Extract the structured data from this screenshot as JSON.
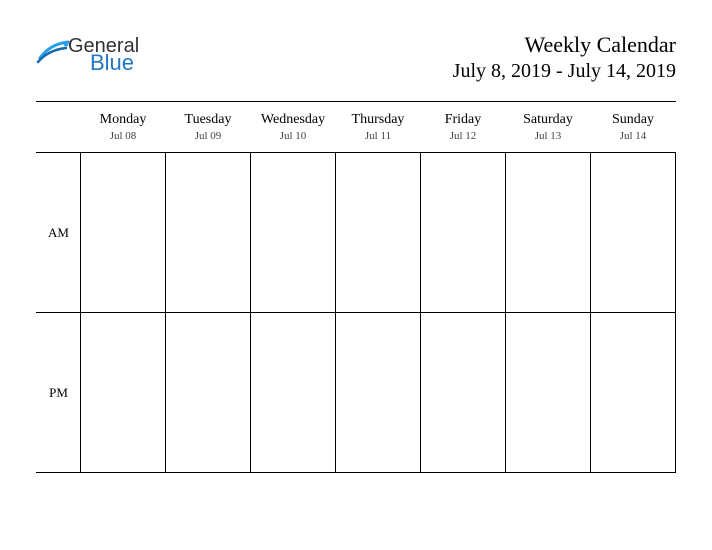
{
  "logo": {
    "word1": "General",
    "word2": "Blue"
  },
  "header": {
    "title": "Weekly Calendar",
    "date_range": "July 8, 2019 - July 14, 2019"
  },
  "days": [
    {
      "name": "Monday",
      "date": "Jul 08"
    },
    {
      "name": "Tuesday",
      "date": "Jul 09"
    },
    {
      "name": "Wednesday",
      "date": "Jul 10"
    },
    {
      "name": "Thursday",
      "date": "Jul 11"
    },
    {
      "name": "Friday",
      "date": "Jul 12"
    },
    {
      "name": "Saturday",
      "date": "Jul 13"
    },
    {
      "name": "Sunday",
      "date": "Jul 14"
    }
  ],
  "periods": [
    {
      "label": "AM"
    },
    {
      "label": "PM"
    }
  ]
}
